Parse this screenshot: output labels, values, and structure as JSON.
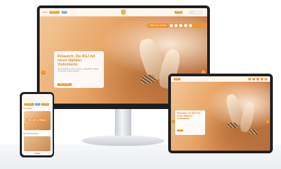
{
  "monitor": {
    "nav": {
      "logo": "BSJ",
      "pill_orange": "Entdecken",
      "pill_blue": "Info",
      "cta_button": "Kontakt",
      "search_placeholder": "Suche"
    },
    "hero": {
      "bar_title": "Willkommen bei BSJ",
      "bar_icons": [
        "f",
        "in",
        "t",
        "y",
        "@"
      ],
      "card": {
        "title": "Relaunch: Die BSJ mit neuer digitaler Visitenkarte",
        "body": "Unsere Website in neuem Gewand – übersichtlich, modern und auf allen Geräten optimiert.",
        "cta": "Mehr erfahren"
      },
      "arrow_left": "‹",
      "arrow_right": "›"
    }
  },
  "tablet": {
    "nav": {
      "pill": "Menü",
      "icons": [
        "f",
        "in",
        "t",
        "y",
        "@"
      ]
    },
    "card": {
      "title": "Relaunch: Die BSJ mit neuer digitaler Visitenkarte",
      "cta": "Mehr"
    },
    "arrow_left": "‹",
    "arrow_right": "›"
  },
  "phone": {
    "pills": [
      "Entdecken",
      "Info",
      "Kontakt"
    ],
    "section_label": "BSJ News",
    "thumb_caption": "Was gibt es Neues",
    "section_label_2": "BSJ BEI DEN BSJ",
    "home_icon": "⌂"
  },
  "colors": {
    "accent": "#f0932b",
    "accent_dark": "#e8892c",
    "blue": "#6ea2e6"
  }
}
